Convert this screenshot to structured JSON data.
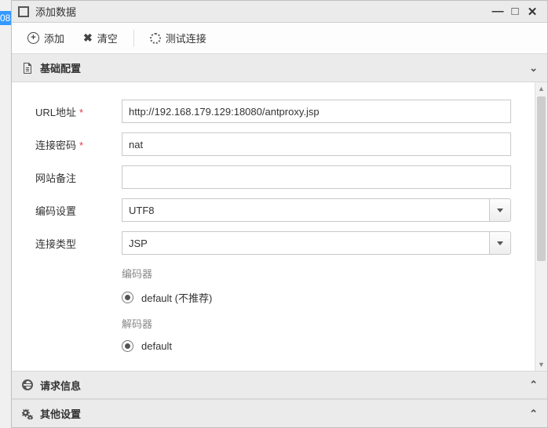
{
  "stray_text": "08",
  "window": {
    "title": "添加数据"
  },
  "toolbar": {
    "add_label": "添加",
    "clear_label": "清空",
    "test_label": "测试连接"
  },
  "sections": {
    "basic": {
      "title": "基础配置"
    },
    "request": {
      "title": "请求信息"
    },
    "other": {
      "title": "其他设置"
    }
  },
  "form": {
    "url": {
      "label": "URL地址",
      "value": "http://192.168.179.129:18080/antproxy.jsp"
    },
    "password": {
      "label": "连接密码",
      "value": "nat"
    },
    "remark": {
      "label": "网站备注",
      "value": ""
    },
    "encoding": {
      "label": "编码设置",
      "value": "UTF8"
    },
    "conn_type": {
      "label": "连接类型",
      "value": "JSP"
    },
    "encoder_label": "编码器",
    "encoder_default": "default (不推荐)",
    "decoder_label": "解码器",
    "decoder_default": "default"
  }
}
